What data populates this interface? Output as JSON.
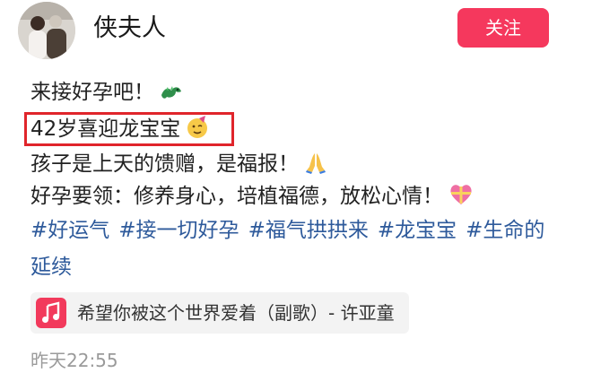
{
  "header": {
    "author_name": "侠夫人",
    "follow_label": "关注",
    "accent_color": "#f5385d"
  },
  "post": {
    "line1": "来接好孕吧！",
    "line2": "42岁喜迎龙宝宝",
    "line3": "孩子是上天的馈赠，是福报！",
    "line4": "好孕要领：修养身心，培植福德，放松心情！",
    "hashtags": [
      "#好运气",
      "#接一切好孕",
      "#福气拱拱来",
      "#龙宝宝",
      "#生命的"
    ],
    "hashtag_continued": "延续",
    "icons": [
      "dragon-emoji-icon",
      "party-face-emoji-icon",
      "praying-hands-emoji-icon",
      "heart-gift-emoji-icon"
    ],
    "highlight_color": "#e0252b"
  },
  "music": {
    "title": "希望你被这个世界爱着（副歌）- 许亚童",
    "icon": "music-note-icon"
  },
  "meta": {
    "timestamp": "昨天22:55"
  }
}
